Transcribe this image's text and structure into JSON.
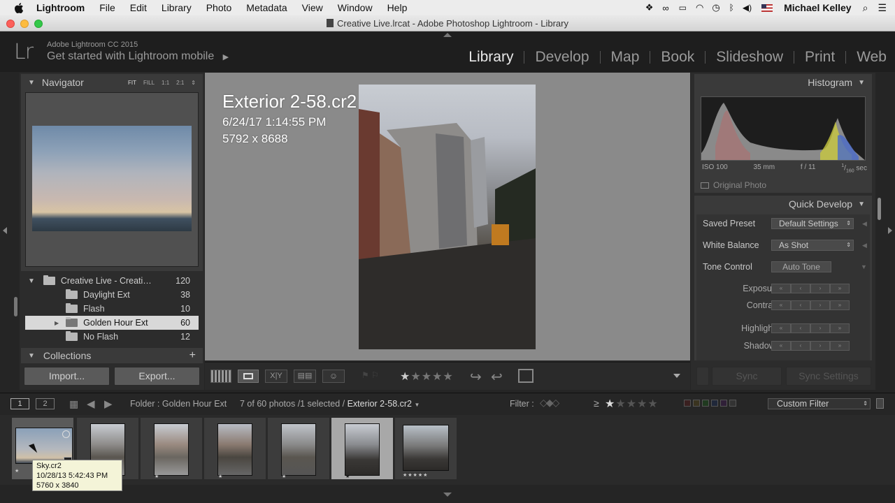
{
  "menubar": {
    "app_name": "Lightroom",
    "items": [
      "File",
      "Edit",
      "Library",
      "Photo",
      "Metadata",
      "View",
      "Window",
      "Help"
    ],
    "user": "Michael Kelley"
  },
  "window_title": "Creative Live.lrcat - Adobe Photoshop Lightroom - Library",
  "identity_plate": {
    "logo": "Lr",
    "product": "Adobe Lightroom CC 2015",
    "cta": "Get started with Lightroom mobile"
  },
  "modules": [
    "Library",
    "Develop",
    "Map",
    "Book",
    "Slideshow",
    "Print",
    "Web"
  ],
  "navigator": {
    "title": "Navigator",
    "zoom_options": [
      "FIT",
      "FILL",
      "1:1",
      "2:1"
    ]
  },
  "folders": {
    "root": {
      "name": "Creative Live - Creati…",
      "count": "120"
    },
    "items": [
      {
        "name": "Daylight Ext",
        "count": "38"
      },
      {
        "name": "Flash",
        "count": "10"
      },
      {
        "name": "Golden Hour Ext",
        "count": "60"
      },
      {
        "name": "No Flash",
        "count": "12"
      }
    ]
  },
  "collections": {
    "title": "Collections",
    "add": "+"
  },
  "buttons": {
    "import": "Import...",
    "export": "Export..."
  },
  "photo_info": {
    "filename": "Exterior 2-58.cr2",
    "datetime": "6/24/17 1:14:55 PM",
    "dimensions": "5792 x 8688"
  },
  "histogram": {
    "title": "Histogram",
    "iso": "ISO 100",
    "focal": "35 mm",
    "aperture": "f / 11",
    "shutter_num": "1",
    "shutter_den": "160",
    "shutter_unit": "sec",
    "original_photo": "Original Photo"
  },
  "quick_develop": {
    "title": "Quick Develop",
    "saved_preset_label": "Saved Preset",
    "saved_preset_value": "Default Settings",
    "white_balance_label": "White Balance",
    "white_balance_value": "As Shot",
    "tone_control_label": "Tone Control",
    "auto_tone": "Auto Tone",
    "rows": [
      "Exposure",
      "Contrast",
      "Highlights",
      "Shadows"
    ]
  },
  "sync": {
    "sync": "Sync",
    "sync_settings": "Sync Settings"
  },
  "filmstrip_bar": {
    "page1": "1",
    "page2": "2",
    "source": "Folder : Golden Hour Ext",
    "count": "7 of 60 photos /1 selected /",
    "current": "Exterior 2-58.cr2",
    "filter_label": "Filter :",
    "ge": "≥",
    "custom_filter": "Custom Filter"
  },
  "tooltip": {
    "name": "Sky.cr2",
    "date": "10/28/13 5:42:43 PM",
    "dims": "5760 x 3840"
  },
  "thumb_ratings": [
    "★",
    "★",
    "★",
    "★",
    "★",
    "★",
    "★★★★★"
  ],
  "colors": {
    "panel": "#3a3a3a",
    "bg": "#252525",
    "selected_thumb": "#a8a8a8",
    "active_module": "#e8e8e8"
  }
}
